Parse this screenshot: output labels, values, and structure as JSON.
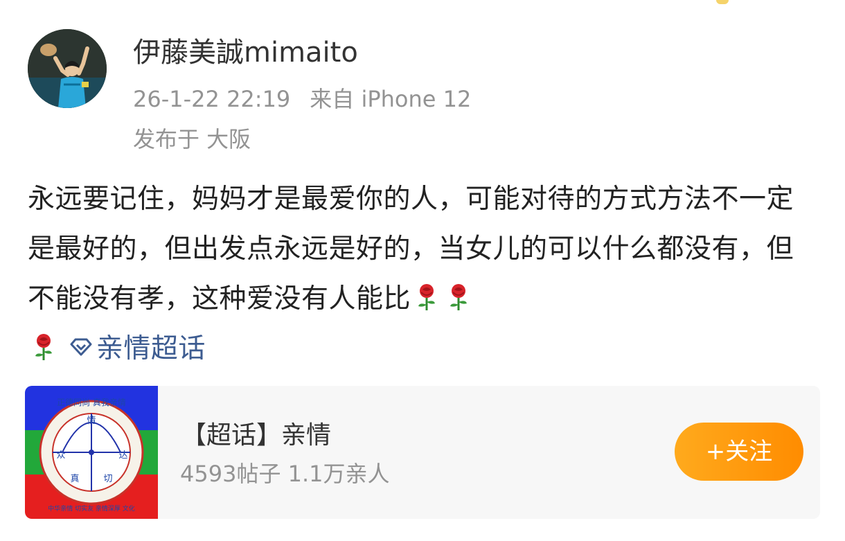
{
  "post": {
    "author": "伊藤美誠mimaito",
    "timestamp": "26-1-22 22:19",
    "source": "来自 iPhone 12",
    "location": "发布于 大阪",
    "text": "永远要记住，妈妈才是最爱你的人，可能对待的方式方法不一定是最好的，但出发点永远是好的，当女儿的可以什么都没有，但不能没有孝，这种爱没有人能比",
    "emoji": [
      "rose-icon",
      "rose-icon",
      "rose-icon"
    ],
    "topic_link": "亲情超话"
  },
  "topic_card": {
    "title": "【超话】亲情",
    "stats": "4593帖子 1.1万亲人",
    "follow_label": "+关注",
    "logo_text": {
      "top": "正德同尚 真我亲情",
      "center_top": "情",
      "left": "众",
      "right": "达",
      "bottom_left": "真",
      "bottom_right": "切",
      "ring": "中华亲情 切实友 亲情深厚 文化"
    }
  },
  "colors": {
    "accent_follow": "#ff9a0f",
    "link": "#3d5c91",
    "meta_text": "#939393",
    "card_bg": "#f7f7f7"
  }
}
